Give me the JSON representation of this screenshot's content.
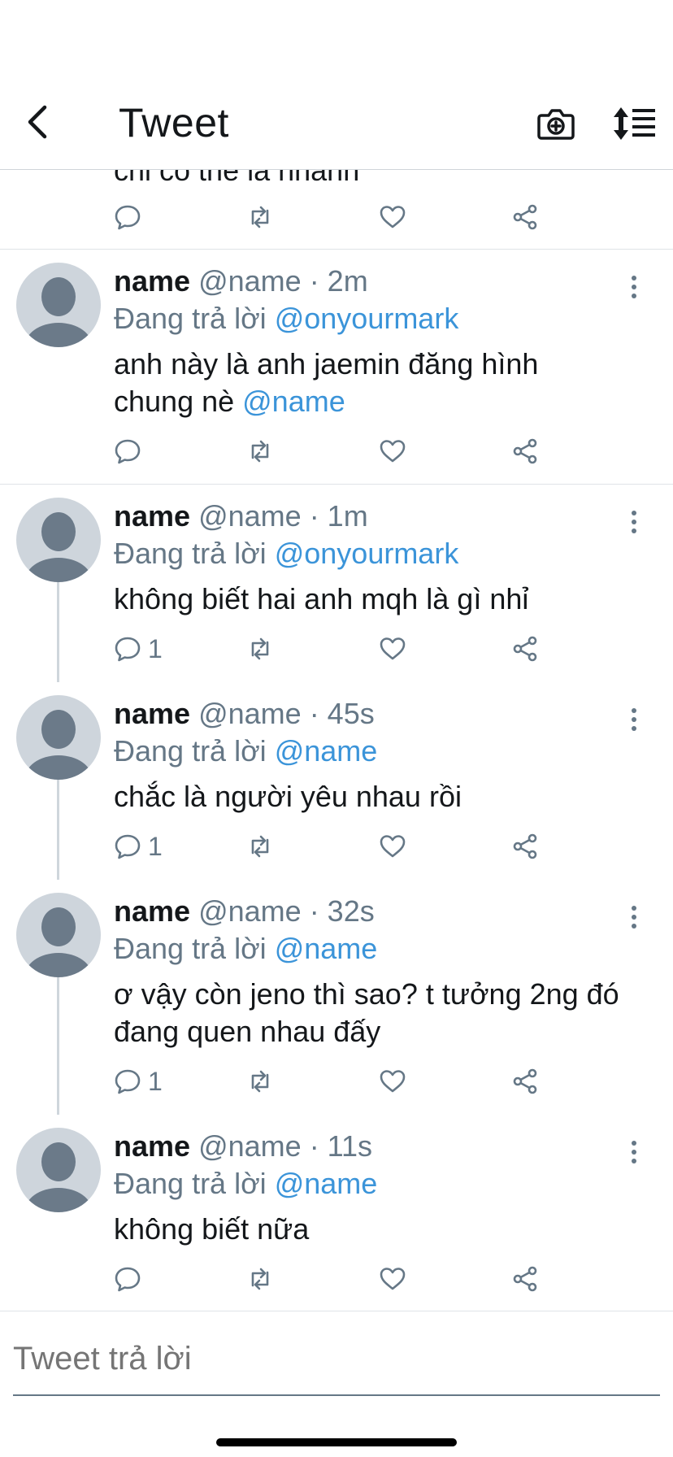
{
  "header": {
    "title": "Tweet"
  },
  "partial_tweet": {
    "text": "chỉ có thể là nhanh"
  },
  "reply_prefix": "Đang trả lời",
  "tweets": [
    {
      "name": "name",
      "handle": "@name",
      "time": "· 2m",
      "reply_to": "@onyourmark",
      "text_plain": " anh này là anh jaemin đăng hình chung nè ",
      "text_mention": "@name",
      "reply_count": ""
    },
    {
      "name": "name",
      "handle": "@name",
      "time": "· 1m",
      "reply_to": "@onyourmark",
      "text_plain": "không biết hai anh mqh là gì nhỉ",
      "text_mention": "",
      "reply_count": "1"
    },
    {
      "name": "name",
      "handle": "@name",
      "time": "· 45s",
      "reply_to": "@name",
      "text_plain": "chắc là người yêu nhau rồi",
      "text_mention": "",
      "reply_count": "1"
    },
    {
      "name": "name",
      "handle": "@name",
      "time": "· 32s",
      "reply_to": "@name",
      "text_plain": "ơ vậy còn jeno thì sao? t tưởng 2ng đó đang quen nhau đấy",
      "text_mention": "",
      "reply_count": "1"
    },
    {
      "name": "name",
      "handle": "@name",
      "time": "· 11s",
      "reply_to": "@name",
      "text_plain": "không biết nữa",
      "text_mention": "",
      "reply_count": ""
    }
  ],
  "composer": {
    "placeholder": "Tweet trả lời"
  },
  "colors": {
    "accent": "#3b94d9",
    "muted": "#657786",
    "divider": "#dfe3e7",
    "avatar_bg": "#ced5dc",
    "avatar_fg": "#6b7a89"
  }
}
